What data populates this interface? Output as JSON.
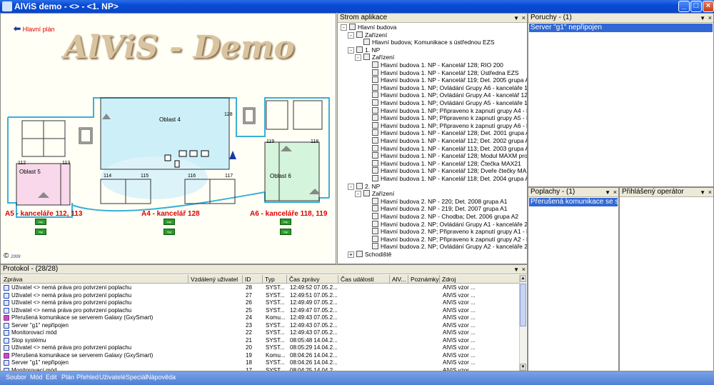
{
  "window": {
    "title": "AlViS demo - <> - <1. NP>"
  },
  "plan": {
    "back_link": "Hlavní plán",
    "logo": "AlViS - Demo",
    "zones": [
      "Oblast 4",
      "Oblast 5",
      "Oblast 6"
    ],
    "rooms": [
      "128",
      "112",
      "113",
      "114",
      "115",
      "116",
      "117",
      "118",
      "119"
    ],
    "groups": [
      {
        "title": "A5 - kanceláře 112, 113",
        "on": "Zap",
        "off": "Vyp"
      },
      {
        "title": "A4 - kancelář 128",
        "on": "Zap",
        "off": "Vyp"
      },
      {
        "title": "A6 - kanceláře 118, 119",
        "on": "Zap",
        "off": "Vyp"
      }
    ],
    "copyright": "©",
    "year": "2009"
  },
  "tree": {
    "title": "Strom aplikace",
    "nodes": [
      {
        "level": 0,
        "text": "Hlavní budova",
        "exp": "-"
      },
      {
        "level": 1,
        "text": "Zařízení",
        "exp": "-"
      },
      {
        "level": 2,
        "text": "Hlavní budova; Komunikace s ústřednou EZS"
      },
      {
        "level": 1,
        "text": "1. NP",
        "exp": "-"
      },
      {
        "level": 2,
        "text": "Zařízení",
        "exp": "-"
      },
      {
        "level": 3,
        "text": "Hlavní budova 1. NP - Kancelář 128; RIO 200"
      },
      {
        "level": 3,
        "text": "Hlavní budova 1. NP - Kancelář 128; Ústředna EZS"
      },
      {
        "level": 3,
        "text": "Hlavní budova 1. NP - Kancelář 119; Det. 2005 grupa A6"
      },
      {
        "level": 3,
        "text": "Hlavní budova 1. NP; Ovládání Grupy A6 - kanceláře 118, 119"
      },
      {
        "level": 3,
        "text": "Hlavní budova 1. NP; Ovládání Grupy A4 - kancelář 128"
      },
      {
        "level": 3,
        "text": "Hlavní budova 1. NP; Ovládání Grupy A5 - kanceláře 112, 113"
      },
      {
        "level": 3,
        "text": "Hlavní budova 1. NP; Připraveno k zapnutí grupy A4 - kancelář 1"
      },
      {
        "level": 3,
        "text": "Hlavní budova 1. NP; Připraveno k zapnutí grupy A5 - kanceláře"
      },
      {
        "level": 3,
        "text": "Hlavní budova 1. NP; Připraveno k zapnutí grupy A6 - kanceláře"
      },
      {
        "level": 3,
        "text": "Hlavní budova 1. NP - Kancelář 128; Det. 2001 grupa A4"
      },
      {
        "level": 3,
        "text": "Hlavní budova 1. NP - Kancelář 112; Det. 2002 grupa A5"
      },
      {
        "level": 3,
        "text": "Hlavní budova 1. NP - Kancelář 113; Det. 2003 grupa A5"
      },
      {
        "level": 3,
        "text": "Hlavní budova 1. NP - Kancelář 128; Modul MAXM pro čtečku M"
      },
      {
        "level": 3,
        "text": "Hlavní budova 1. NP - Kancelář 128; Čtečka MAX21"
      },
      {
        "level": 3,
        "text": "Hlavní budova 1. NP - Kancelář 128; Dveře čtečky MAX21"
      },
      {
        "level": 3,
        "text": "Hlavní budova 1. NP - Kancelář 118; Det. 2004 grupa A6"
      },
      {
        "level": 1,
        "text": "2. NP",
        "exp": "-"
      },
      {
        "level": 2,
        "text": "Zařízení",
        "exp": "-"
      },
      {
        "level": 3,
        "text": "Hlavní budova 2. NP - 220; Det. 2008 grupa A1"
      },
      {
        "level": 3,
        "text": "Hlavní budova 2. NP - 219; Det. 2007 grupa A1"
      },
      {
        "level": 3,
        "text": "Hlavní budova 2. NP - Chodba; Det. 2006 grupa A2"
      },
      {
        "level": 3,
        "text": "Hlavní budova 2. NP; Ovládání Grupy A1 - kanceláře 219 až 220"
      },
      {
        "level": 3,
        "text": "Hlavní budova 2. NP; Připraveno k zapnutí grupy A1 - kanceláře"
      },
      {
        "level": 3,
        "text": "Hlavní budova 2. NP; Připraveno k zapnutí grupy A2 - kanceláře"
      },
      {
        "level": 3,
        "text": "Hlavní budova 2. NP; Ovládání Grupy A2 - kanceláře 212, 213"
      },
      {
        "level": 1,
        "text": "Schodiště",
        "exp": "+"
      }
    ]
  },
  "poruchy": {
    "title": "Poruchy - (1)",
    "items": [
      "Server  \"g1\" nepřipojen"
    ]
  },
  "poplachy": {
    "title": "Poplachy - (1)",
    "items": [
      "Přerušená komunikace se serverem G"
    ]
  },
  "operator": {
    "title": "Přihlášený operátor"
  },
  "protokol": {
    "title": "Protokol -  (28/28)",
    "columns": [
      "Zpráva",
      "Vzdálený uživatel",
      "ID",
      "Typ",
      "Čas zprávy",
      "Čas události",
      "AlV...",
      "Poznámky",
      "Zdroj"
    ],
    "rows": [
      {
        "msg": "Uživatel <> nemá práva pro potvrzení poplachu",
        "id": "28",
        "type": "SYST...",
        "time": "12:49:52  07.05.2...",
        "src": "AlViS vzor ...",
        "k": false
      },
      {
        "msg": "Uživatel <> nemá práva pro potvrzení poplachu",
        "id": "27",
        "type": "SYST...",
        "time": "12:49:51  07.05.2...",
        "src": "AlViS vzor ...",
        "k": false
      },
      {
        "msg": "Uživatel <> nemá práva pro potvrzení poplachu",
        "id": "26",
        "type": "SYST...",
        "time": "12:49:49  07.05.2...",
        "src": "AlViS vzor ...",
        "k": false
      },
      {
        "msg": "Uživatel <> nemá práva pro potvrzení poplachu",
        "id": "25",
        "type": "SYST...",
        "time": "12:49:47  07.05.2...",
        "src": "AlViS vzor ...",
        "k": false
      },
      {
        "msg": "Přerušená komunikace se serverem Galaxy (GxySmart)",
        "id": "24",
        "type": "Komu...",
        "time": "12:49:43  07.05.2...",
        "src": "AlViS vzor ...",
        "k": true
      },
      {
        "msg": "Server  \"g1\" nepřipojen",
        "id": "23",
        "type": "SYST...",
        "time": "12:49:43  07.05.2...",
        "src": "AlViS vzor ...",
        "k": false
      },
      {
        "msg": "Monitorovací mód",
        "id": "22",
        "type": "SYST...",
        "time": "12:49:43  07.05.2...",
        "src": "AlViS vzor ...",
        "k": false
      },
      {
        "msg": "Stop systému",
        "id": "21",
        "type": "SYST...",
        "time": "08:05:48  14.04.2...",
        "src": "AlViS vzor ...",
        "k": false
      },
      {
        "msg": "Uživatel <> nemá práva pro potvrzení poplachu",
        "id": "20",
        "type": "SYST...",
        "time": "08:05:29  14.04.2...",
        "src": "AlViS vzor ...",
        "k": false
      },
      {
        "msg": "Přerušená komunikace se serverem Galaxy (GxySmart)",
        "id": "19",
        "type": "Komu...",
        "time": "08:04:26  14.04.2...",
        "src": "AlViS vzor ...",
        "k": true
      },
      {
        "msg": "Server  \"g1\" nepřipojen",
        "id": "18",
        "type": "SYST...",
        "time": "08:04:26  14.04.2...",
        "src": "AlViS vzor ...",
        "k": false
      },
      {
        "msg": "Monitorovací mód",
        "id": "17",
        "type": "SYST...",
        "time": "08:04:25  14.04.2...",
        "src": "AlViS vzor ...",
        "k": false
      }
    ]
  },
  "menu": [
    "Soubor",
    "Mód",
    "Edit",
    "Plán",
    "Přehled",
    "Uživatelé",
    "Speciál",
    "Nápověda"
  ],
  "colors": {
    "titlebar": "#0a4bd4",
    "selection": "#3168d5",
    "alarm_text": "#e00000",
    "zone4": "#cdeff8",
    "zone5": "#f8d8ea",
    "zone6": "#d4f4dc",
    "wall": "#3ab0d8"
  }
}
